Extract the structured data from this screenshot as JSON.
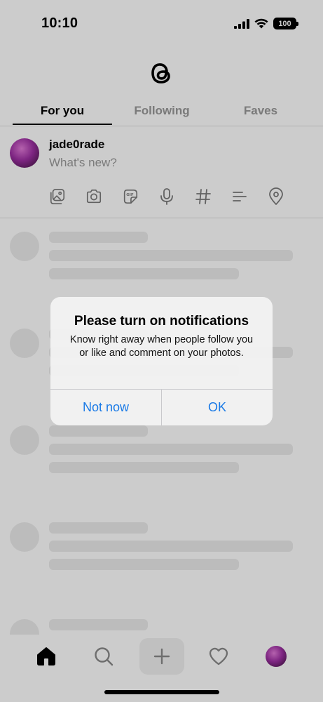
{
  "status_bar": {
    "time": "10:10",
    "battery": "100"
  },
  "tabs": [
    {
      "label": "For you",
      "active": true
    },
    {
      "label": "Following",
      "active": false
    },
    {
      "label": "Faves",
      "active": false
    }
  ],
  "composer": {
    "username": "jade0rade",
    "placeholder": "What's new?",
    "tools": [
      "image-icon",
      "camera-icon",
      "gif-icon",
      "microphone-icon",
      "hashtag-icon",
      "poll-icon",
      "location-icon"
    ]
  },
  "alert": {
    "title": "Please turn on notifications",
    "message": "Know right away when people follow you or like and comment on your photos.",
    "secondary_button": "Not now",
    "primary_button": "OK"
  },
  "bottom_nav": [
    "home-icon",
    "search-icon",
    "compose-icon",
    "activity-icon",
    "profile-avatar"
  ],
  "colors": {
    "accent": "#1a7ae6",
    "inactive_tab": "#999999",
    "skeleton": "#ececec"
  }
}
